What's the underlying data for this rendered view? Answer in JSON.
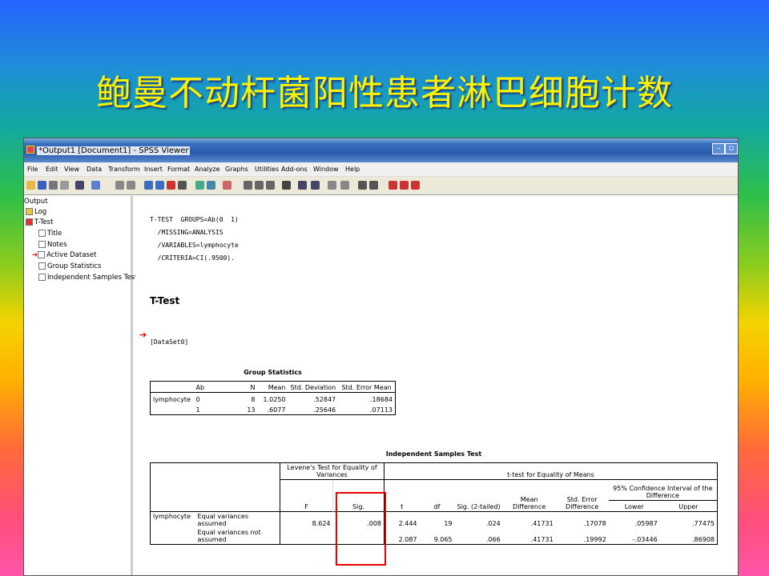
{
  "slide": {
    "title": "鲍曼不动杆菌阳性患者淋巴细胞计数"
  },
  "window": {
    "title": "*Output1 [Document1] - SPSS Viewer"
  },
  "menu": [
    "File",
    "Edit",
    "View",
    "Data",
    "Transform",
    "Insert",
    "Format",
    "Analyze",
    "Graphs",
    "Utilities",
    "Add-ons",
    "Window",
    "Help"
  ],
  "tree": {
    "root": "Output",
    "log": "Log",
    "ttest": "T-Test",
    "items": [
      "Title",
      "Notes",
      "Active Dataset",
      "Group Statistics",
      "Independent Samples Test"
    ]
  },
  "syntax": "T-TEST  GROUPS=Ab(0  1)\n  /MISSING=ANALYSIS\n  /VARIABLES=lymphocyte\n  /CRITERIA=CI(.9500).",
  "heading": "T-Test",
  "dataset": "[DataSet0]",
  "group_statistics": {
    "caption": "Group Statistics",
    "headers": [
      "",
      "Ab",
      "N",
      "Mean",
      "Std. Deviation",
      "Std. Error Mean"
    ],
    "variable": "lymphocyte",
    "rows": [
      [
        "0",
        "8",
        "1.0250",
        ".52847",
        ".18684"
      ],
      [
        "1",
        "13",
        ".6077",
        ".25646",
        ".07113"
      ]
    ]
  },
  "independent_test": {
    "caption": "Independent Samples Test",
    "levene_header": "Levene's Test for Equality of Variances",
    "ttest_header": "t-test for Equality of Means",
    "ci_header": "95% Confidence Interval of the Difference",
    "cols": [
      "F",
      "Sig.",
      "t",
      "df",
      "Sig. (2-tailed)",
      "Mean Difference",
      "Std. Error Difference",
      "Lower",
      "Upper"
    ],
    "variable": "lymphocyte",
    "rows": [
      {
        "label": "Equal variances assumed",
        "F": "8.624",
        "Sig": ".008",
        "t": "2.444",
        "df": "19",
        "sig2": ".024",
        "md": ".41731",
        "sed": ".17078",
        "lower": ".05987",
        "upper": ".77475"
      },
      {
        "label": "Equal variances not assumed",
        "F": "",
        "Sig": "",
        "t": "2.087",
        "df": "9.065",
        "sig2": ".066",
        "md": ".41731",
        "sed": ".19992",
        "lower": "-.03446",
        "upper": ".86908"
      }
    ]
  }
}
